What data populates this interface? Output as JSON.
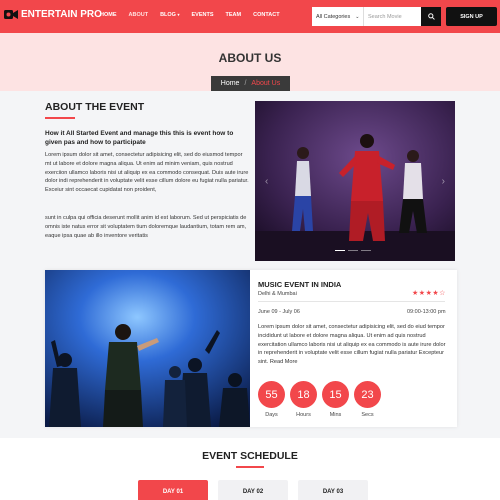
{
  "header": {
    "logo_text": "ENTERTAIN PRO",
    "nav": [
      {
        "label": "HOME",
        "active": false
      },
      {
        "label": "ABOUT",
        "active": true
      },
      {
        "label": "BLOG",
        "active": false,
        "dropdown": true
      },
      {
        "label": "EVENTS",
        "active": false
      },
      {
        "label": "TEAM",
        "active": false
      },
      {
        "label": "CONTACT",
        "active": false
      }
    ],
    "search": {
      "category": "All Categories",
      "placeholder": "Search Movie"
    },
    "signup_label": "SIGN UP"
  },
  "banner": {
    "title": "ABOUT US",
    "breadcrumb": [
      "Home",
      "About Us"
    ]
  },
  "about": {
    "title": "ABOUT THE EVENT",
    "subtitle": "How it All Started Event and manage this this is event how to given pas and how to participate",
    "paragraph1": "Lorem ipsum dolor sit amet, consectetur adipisicing elit, sed do eiusmod tempor mt ut labore et dolore magna aliqua. Ut enim ad minim veniam, quis nostrud exerciion ullamco laboris nisi ut aliquip ex ea commodo consequat. Duis aute irure dolor indi reprehenderit in voluptate velit esse cillum dolore eu fugiat nulla pariatur. Exceiur sint occaecat cupidatat non proident,",
    "paragraph2": "sunt in culpa qui officia deserunt mollit anim id est laborum. Sed ut perspiciatis de omnis iste natus error sit voluptatem tium doloremque laudantium, totam rem am, eaque ipsa quae ab illo inventore veritatis"
  },
  "event": {
    "title": "MUSIC EVENT IN INDIA",
    "location": "Delhi & Mumbai",
    "rating": 4,
    "rating_max": 5,
    "dates": "June 09 - July 06",
    "time": "09:00-13:00 pm",
    "description": "Lorem ipsum dolor sit amet, consectetur adipisicing elit, sed do eiud tempor incididunt ut labore et dolore magna aliqua. Ut enim ad quis nostrud exercitation ullamco laboris nisi ut aliquip ex ea commodo is aute irure dolor in reprehenderit in voluptate velit esse cillum fugiat nulla pariatur Excepteur sint. Read More",
    "countdown": [
      {
        "value": "55",
        "label": "Days"
      },
      {
        "value": "18",
        "label": "Hours"
      },
      {
        "value": "15",
        "label": "Mins"
      },
      {
        "value": "23",
        "label": "Secs"
      }
    ]
  },
  "schedule": {
    "title": "EVENT SCHEDULE",
    "tabs": [
      {
        "label": "DAY 01",
        "active": true
      },
      {
        "label": "DAY 02",
        "active": false
      },
      {
        "label": "DAY 03",
        "active": false
      }
    ]
  },
  "colors": {
    "accent": "#f2474b",
    "banner": "#fde3e3",
    "dark": "#111111"
  }
}
